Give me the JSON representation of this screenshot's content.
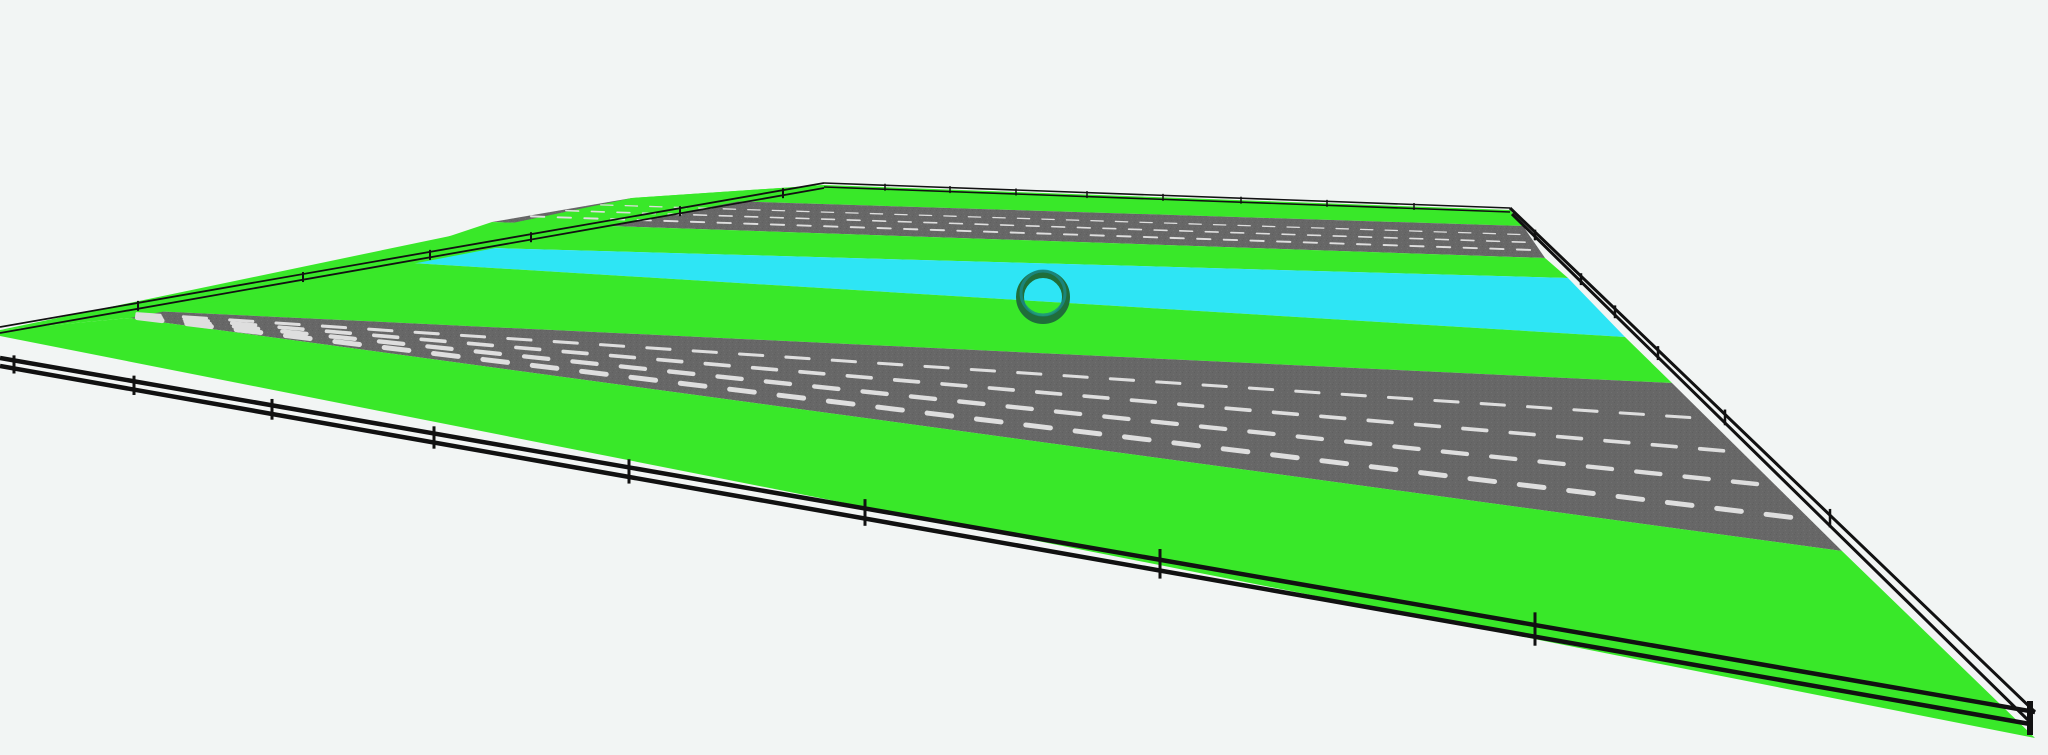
{
  "scene": {
    "type": "3d-perspective-level",
    "background_color": "#f2f5f4",
    "colors": {
      "grass": "#39e829",
      "road": "#676767",
      "road_marking": "#dedede",
      "water": "#2ee5f5",
      "fence": "#111111",
      "player_ring": "#1f6e3a",
      "player_ring_inner": "#1a8a8a"
    },
    "lanes_far_to_near": [
      "grass",
      "road",
      "grass",
      "water",
      "grass",
      "road",
      "grass"
    ],
    "fence": {
      "sides": [
        "left",
        "back",
        "right",
        "front"
      ]
    },
    "player": {
      "shape": "ring",
      "lane": "grass"
    }
  }
}
